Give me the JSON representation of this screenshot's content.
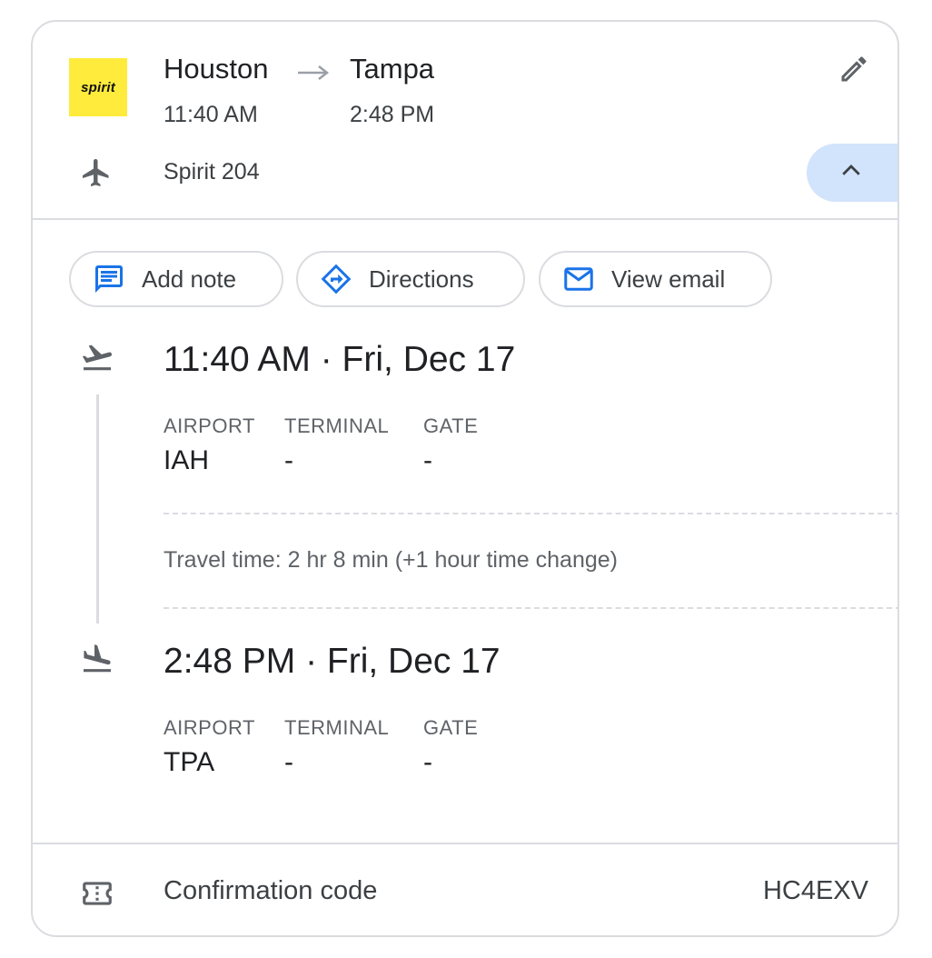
{
  "header": {
    "airline_logo_text": "spirit",
    "from_city": "Houston",
    "to_city": "Tampa",
    "depart_time": "11:40 AM",
    "arrive_time": "2:48 PM",
    "flight_number": "Spirit 204"
  },
  "actions": {
    "add_note": "Add note",
    "directions": "Directions",
    "view_email": "View email"
  },
  "departure": {
    "datetime": "11:40 AM · Fri, Dec 17",
    "airport_label": "AIRPORT",
    "terminal_label": "TERMINAL",
    "gate_label": "GATE",
    "airport": "IAH",
    "terminal": "-",
    "gate": "-"
  },
  "travel_time": "Travel time: 2 hr 8 min (+1 hour time change)",
  "arrival": {
    "datetime": "2:48 PM · Fri, Dec 17",
    "airport_label": "AIRPORT",
    "terminal_label": "TERMINAL",
    "gate_label": "GATE",
    "airport": "TPA",
    "terminal": "-",
    "gate": "-"
  },
  "confirmation": {
    "label": "Confirmation code",
    "code": "HC4EXV"
  },
  "colors": {
    "accent_blue": "#1a73e8",
    "logo_yellow": "#ffeb3b",
    "collapse_bg": "#d2e3fc",
    "border": "#dadce0"
  },
  "icons": [
    "airline-logo",
    "arrow-right-icon",
    "edit-pencil-icon",
    "airplane-icon",
    "chevron-up-icon",
    "note-icon",
    "directions-icon",
    "email-icon",
    "takeoff-icon",
    "landing-icon",
    "ticket-icon"
  ]
}
